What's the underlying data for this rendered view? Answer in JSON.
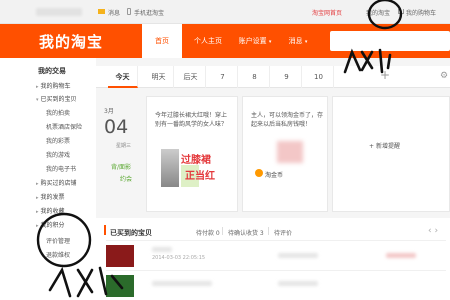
{
  "topbar": {
    "messages": "消息",
    "mobile_taobao": "手机逛淘宝",
    "taobao_home": "淘宝网首页",
    "my_taobao": "我的淘宝",
    "cart": "我的购物车"
  },
  "header": {
    "logo": "我的淘宝",
    "nav": [
      "首页",
      "个人主页",
      "账户设置",
      "消息"
    ]
  },
  "sidebar": {
    "title": "我的交易",
    "items": [
      "我的购物车",
      "已买到的宝贝",
      "我的拍卖",
      "机票酒店保险",
      "我的彩票",
      "我的游戏",
      "我的电子书",
      "购买过的店铺",
      "我的发票",
      "我的收藏",
      "我的积分",
      "评价管理",
      "退款维权"
    ],
    "icons": [
      "triangle-right",
      "triangle-down"
    ]
  },
  "calendar": {
    "days": [
      "今天",
      "明天",
      "后天",
      "7",
      "8",
      "9",
      "10"
    ],
    "month": "3月",
    "day": "04",
    "weekday": "星期三",
    "tag1": "背/面影",
    "tag2": "约会"
  },
  "cards": {
    "card1_text": [
      "今年过膝长裙大红哦！穿上",
      "别有一番韵风学的女人味？"
    ],
    "promo_line1": "过膝裙",
    "promo_line2": "正当红",
    "card2_text": [
      "主人，可以领淘金币了，存",
      "起来以后当私房钱哦！"
    ],
    "coin_label": "淘金币",
    "add_reminder": "新增提醒"
  },
  "orders": {
    "title": "已买到的宝贝",
    "tabs": [
      "待付款 0",
      "待确认收货 3",
      "待评价"
    ],
    "row1_date": "2014-03-03 22:05:15"
  },
  "colors": {
    "brand_orange": "#ff5000",
    "link_red": "#e4393c",
    "green": "#5aa831"
  }
}
